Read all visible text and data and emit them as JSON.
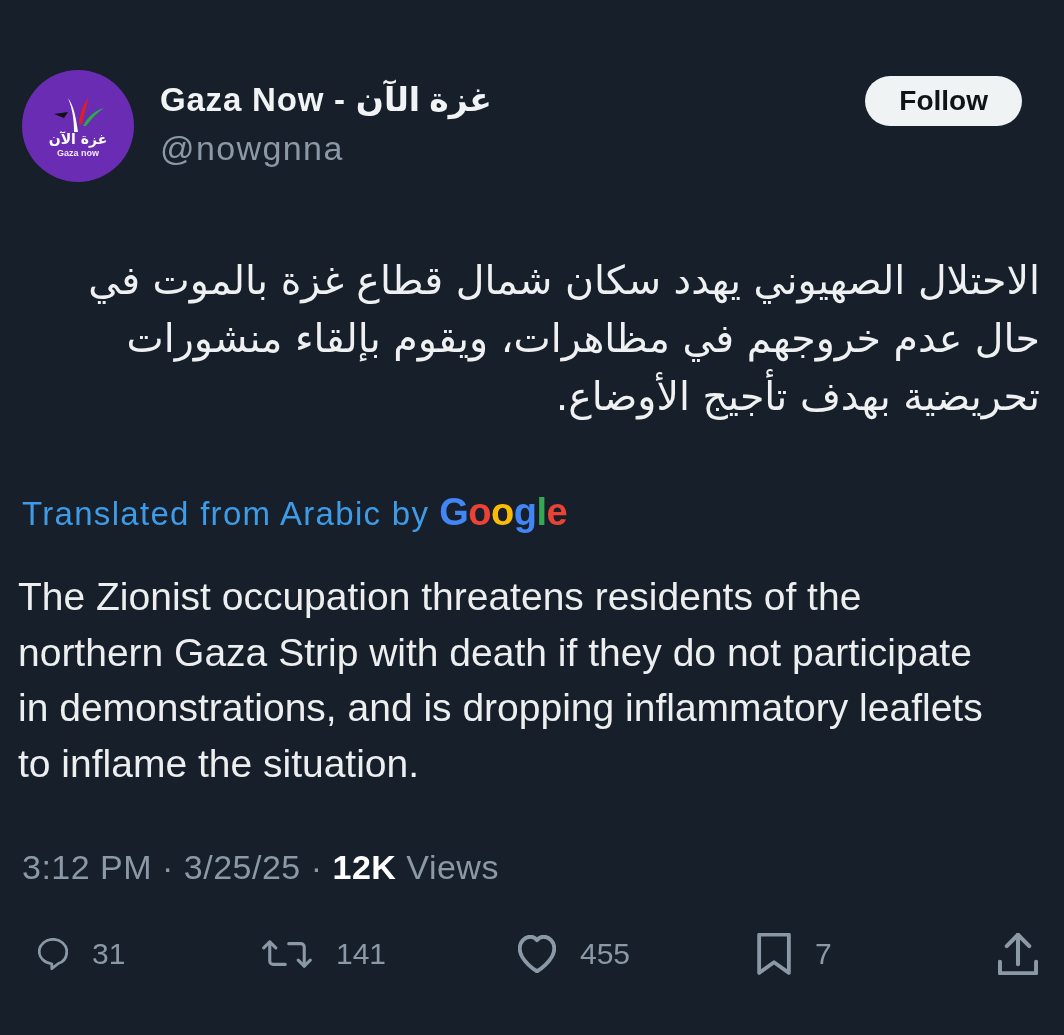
{
  "tweet": {
    "author": {
      "avatar": {
        "arabic_text": "غزة الآن",
        "caption": "Gaza now"
      },
      "name": "Gaza Now - غزة الآن",
      "handle": "@nowgnna"
    },
    "follow_button": "Follow",
    "text": "الاحتلال الصهيوني يهدد سكان شمال قطاع غزة بالموت في حال عدم خروجهم في مظاهرات، ويقوم بإلقاء منشورات تحريضية بهدف تأجيج الأوضاع.",
    "translation": {
      "label": "Translated from Arabic by",
      "provider": "Google",
      "text": "The Zionist occupation threatens residents of the northern Gaza Strip with death if they do not participate in demonstrations, and is dropping inflammatory leaflets to inflame the situation."
    },
    "meta": "3:12 PM · 3/25/25 · **12K** Views",
    "actions": [
      {
        "kind": "reply",
        "count": "31"
      },
      {
        "kind": "repost",
        "count": "141"
      },
      {
        "kind": "like",
        "count": "455"
      },
      {
        "kind": "bookmark",
        "count": "7"
      },
      {
        "kind": "share"
      }
    ]
  }
}
